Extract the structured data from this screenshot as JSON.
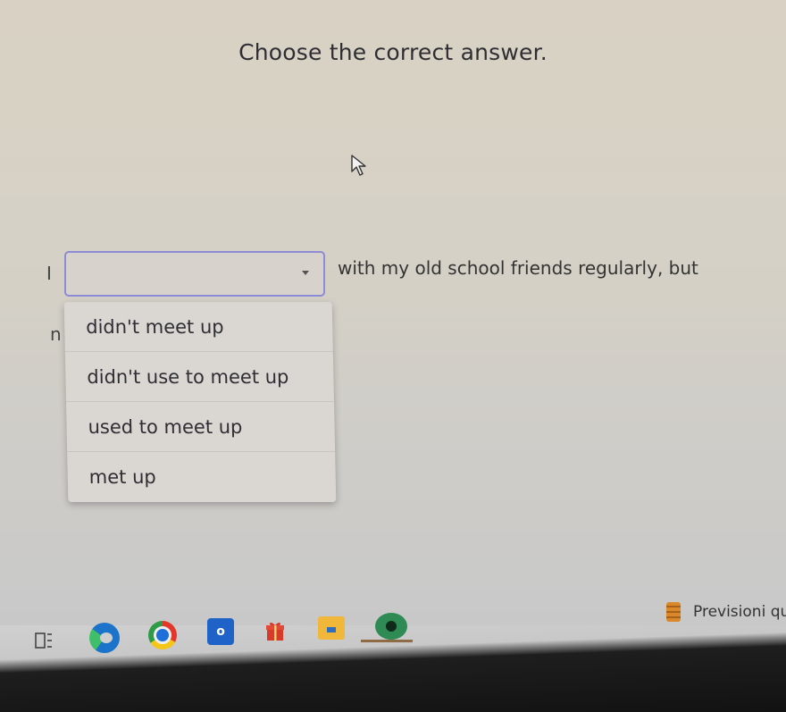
{
  "question": {
    "title": "Choose the correct answer.",
    "prefix": "I",
    "prefix_line2": "n",
    "suffix": "with my old school friends regularly, but",
    "selected_value": ""
  },
  "dropdown": {
    "options": [
      {
        "label": "didn't meet up"
      },
      {
        "label": "didn't use to meet up"
      },
      {
        "label": "used to meet up"
      },
      {
        "label": "met up"
      }
    ]
  },
  "taskbar": {
    "weather_label": "Previsioni qua",
    "outlook_letter": "o",
    "icons": [
      "task-view-icon",
      "edge-icon",
      "chrome-icon",
      "outlook-icon",
      "gift-icon",
      "file-explorer-icon",
      "chat-icon"
    ]
  },
  "colors": {
    "select_border": "#8d8ad6",
    "text": "#2e2e34"
  }
}
